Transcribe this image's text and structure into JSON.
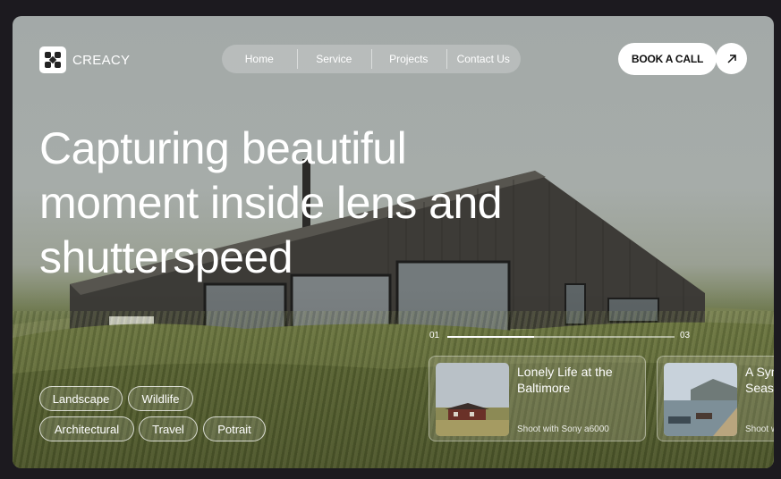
{
  "brand": {
    "name": "CREACY"
  },
  "nav": {
    "items": [
      "Home",
      "Service",
      "Projects",
      "Contact Us"
    ]
  },
  "cta": {
    "label": "BOOK A CALL",
    "icon": "arrow-up-right-icon"
  },
  "hero": {
    "lines": [
      "Capturing beautiful",
      "moment inside lens and",
      "shutterspeed"
    ]
  },
  "tags": [
    "Landscape",
    "Wildlife",
    "Architectural",
    "Travel",
    "Potrait"
  ],
  "slider": {
    "start": "01",
    "end": "03",
    "progress": 0.38
  },
  "cards": [
    {
      "title": "Lonely Life at the Baltimore",
      "subtitle": "Shoot with Sony a6000"
    },
    {
      "title": "A Sym Seas",
      "subtitle": "Shoot w"
    }
  ]
}
